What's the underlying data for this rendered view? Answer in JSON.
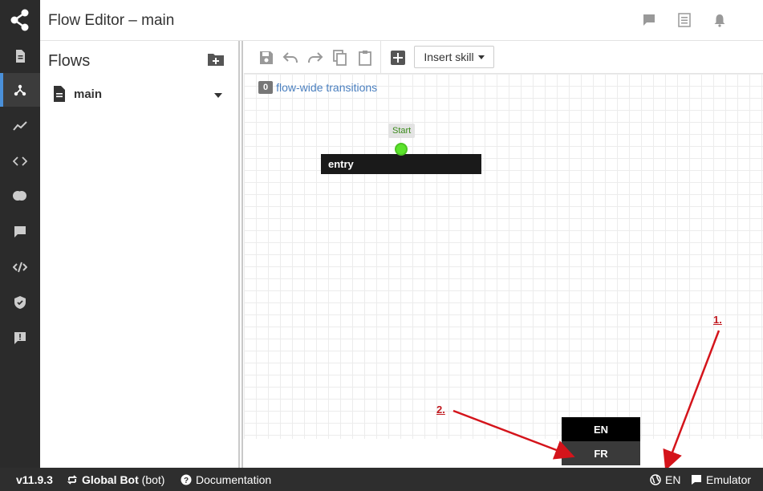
{
  "header": {
    "title": "Flow Editor – main"
  },
  "flows": {
    "title": "Flows",
    "items": [
      {
        "label": "main"
      }
    ]
  },
  "toolbar": {
    "insert_skill_label": "Insert skill"
  },
  "canvas": {
    "flow_wide_count": "0",
    "flow_wide_label": "flow-wide transitions",
    "start_label": "Start",
    "entry_label": "entry"
  },
  "lang_menu": {
    "options": [
      {
        "label": "EN",
        "selected": true
      },
      {
        "label": "FR",
        "selected": false
      }
    ]
  },
  "annotations": {
    "label_1": "1.",
    "label_2": "2.",
    "color": "#c0181e"
  },
  "statusbar": {
    "version": "v11.9.3",
    "bot_name": "Global Bot",
    "bot_id": "(bot)",
    "documentation": "Documentation",
    "language": "EN",
    "emulator": "Emulator"
  },
  "icons": {
    "leftnav": [
      "logo-share-icon",
      "content-icon",
      "flows-icon",
      "analytics-icon",
      "code-icon",
      "toggle-icon",
      "chat-icon",
      "nlu-icon",
      "shield-icon",
      "feedback-icon"
    ],
    "header": [
      "comment-icon",
      "log-icon",
      "bell-icon"
    ]
  }
}
